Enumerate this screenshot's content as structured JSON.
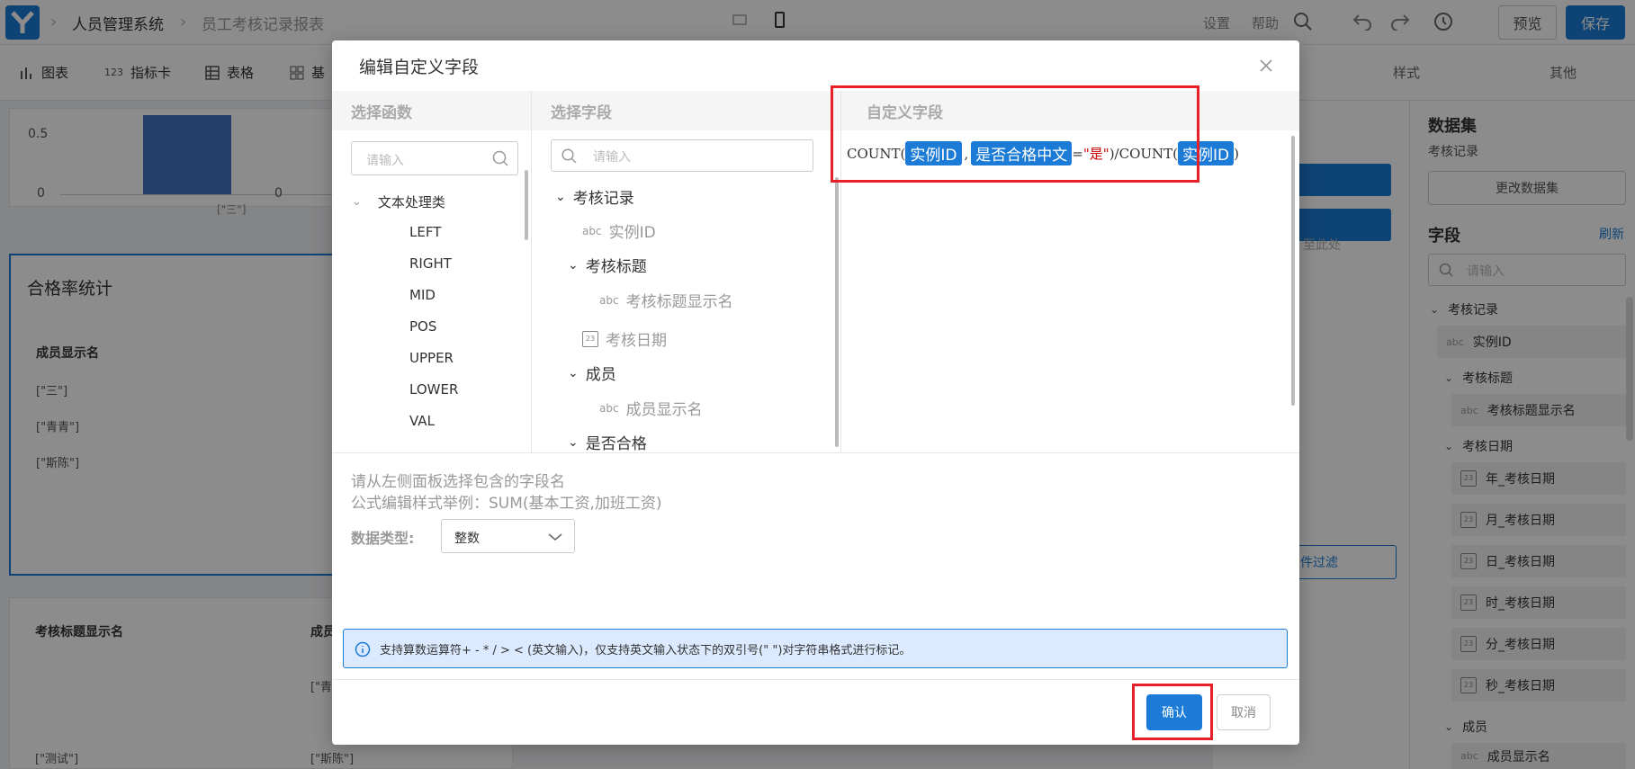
{
  "topbar": {
    "app_name": "人员管理系统",
    "page_name": "员工考核记录报表",
    "settings": "设置",
    "help": "帮助",
    "preview": "预览",
    "save": "保存"
  },
  "toolbar": {
    "chart": "图表",
    "indicator": "指标卡",
    "table": "表格",
    "basic": "基",
    "indicator_prefix": "123",
    "style_tab": "样式",
    "other_tab": "其他"
  },
  "canvas": {
    "axis_05": "0.5",
    "axis_0": "0",
    "bar_zero": "0",
    "bar_label": "[\"三\"]",
    "card_title": "合格率统计",
    "col_member": "成员显示名",
    "rows": [
      "[\"三\"]",
      "[\"青青\"]",
      "[\"斯陈\"]"
    ],
    "col_title": "考核标题显示名",
    "col_member_short": "成员",
    "bottom_row_a": "[\"青",
    "bottom_row_b": "[\"测试\"]",
    "bottom_row_c": "[\"斯陈\"]",
    "drag_hint": "至此处",
    "filter_btn": "件过滤"
  },
  "rightpanel": {
    "dataset_title": "数据集",
    "dataset_name": "考核记录",
    "change_dataset": "更改数据集",
    "fields_title": "字段",
    "refresh": "刷新",
    "search_placeholder": "请输入",
    "group_record": "考核记录",
    "f_instance": "实例ID",
    "group_title": "考核标题",
    "f_title_name": "考核标题显示名",
    "group_date": "考核日期",
    "date_fields": [
      "年_考核日期",
      "月_考核日期",
      "日_考核日期",
      "时_考核日期",
      "分_考核日期",
      "秒_考核日期"
    ],
    "group_member": "成员",
    "f_member_name": "成员显示名",
    "abc": "abc",
    "cal": "23"
  },
  "modal": {
    "title": "编辑自定义字段",
    "col_functions": "选择函数",
    "col_fields": "选择字段",
    "col_custom": "自定义字段",
    "fn_search_placeholder": "请输入",
    "field_search_placeholder": "请输入",
    "fn_group": "文本处理类",
    "functions": [
      "LEFT",
      "RIGHT",
      "MID",
      "POS",
      "UPPER",
      "LOWER",
      "VAL"
    ],
    "tree": {
      "record": "考核记录",
      "instance": "实例ID",
      "title_group": "考核标题",
      "title_name": "考核标题显示名",
      "date": "考核日期",
      "member_group": "成员",
      "member_name": "成员显示名",
      "pass_group": "是否合格",
      "abc": "abc",
      "cal": "23"
    },
    "formula": {
      "count1": "COUNT(",
      "tag1": "实例ID",
      "comma": ",",
      "tag2": "是否合格中文",
      "eq": "=",
      "str": "\"是\"",
      "mid": ")/COUNT(",
      "tag3": "实例ID",
      "close": ")"
    },
    "hint1": "请从左侧面板选择包含的字段名",
    "hint2": "公式编辑样式举例：SUM(基本工资,加班工资)",
    "datatype_label": "数据类型:",
    "datatype_value": "整数",
    "info": "支持算数运算符+ - * / > < (英文输入)，仅支持英文输入状态下的双引号(\" \")对字符串格式进行标记。",
    "confirm": "确认",
    "cancel": "取消"
  },
  "colors": {
    "accent": "#1b7bd6",
    "highlight": "#e8202a",
    "info_bg": "#dbeafe"
  }
}
